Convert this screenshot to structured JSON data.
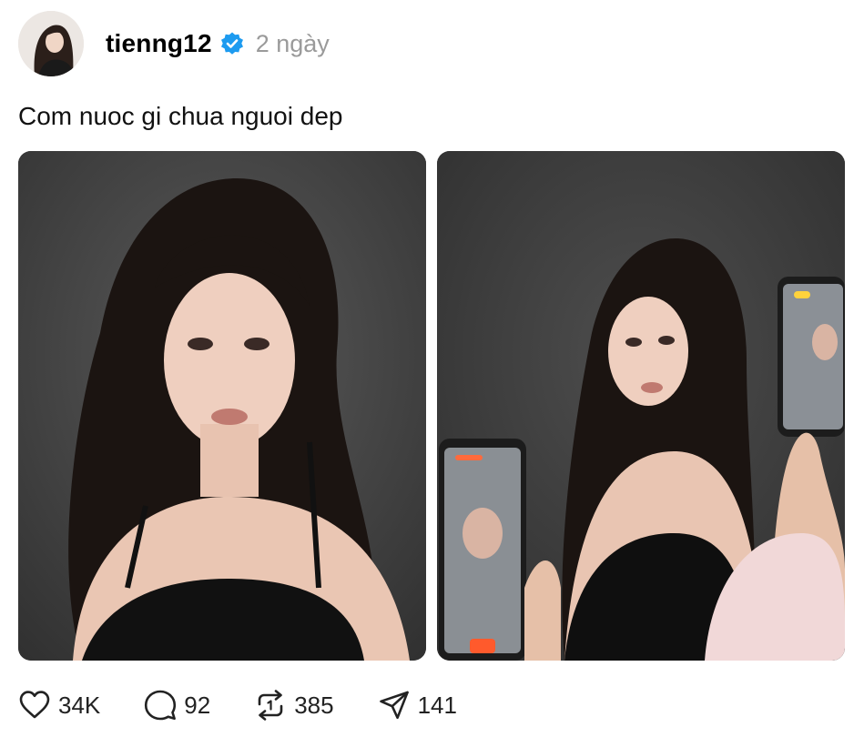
{
  "post": {
    "username": "tienng12",
    "time": "2 ngày",
    "caption": "Com nuoc gi chua nguoi dep"
  },
  "actions": {
    "likes": "34K",
    "replies": "92",
    "reposts": "385",
    "shares": "141"
  },
  "colors": {
    "verified": "#1d9bf0",
    "muted_text": "#9a9a9a",
    "photo_background": "#3a3a3a"
  },
  "icons": {
    "like": "heart-icon",
    "reply": "comment-icon",
    "repost": "repost-icon",
    "share": "send-icon",
    "verified": "verified-badge-icon"
  }
}
